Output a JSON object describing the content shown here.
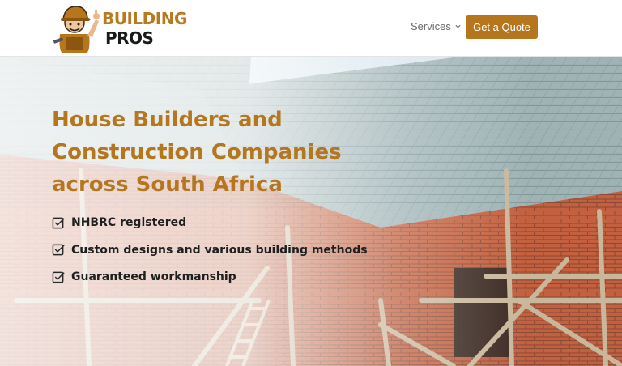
{
  "header": {
    "logo": {
      "line1": "BUILDING",
      "line2": "PROS"
    },
    "nav": {
      "services_label": "Services"
    },
    "cta_label": "Get a Quote"
  },
  "hero": {
    "title_lines": [
      "House Builders and",
      "Construction Companies",
      "across South Africa"
    ],
    "features": [
      "NHBRC registered",
      "Custom designs and various building methods",
      "Guaranteed workmanship"
    ]
  },
  "colors": {
    "accent": "#b5761e",
    "text_dark": "#1f1f1f",
    "nav_text": "#6b6b6b"
  },
  "icons": [
    "builder-mascot-icon",
    "chevron-down-icon",
    "checkbox-checked-icon"
  ]
}
